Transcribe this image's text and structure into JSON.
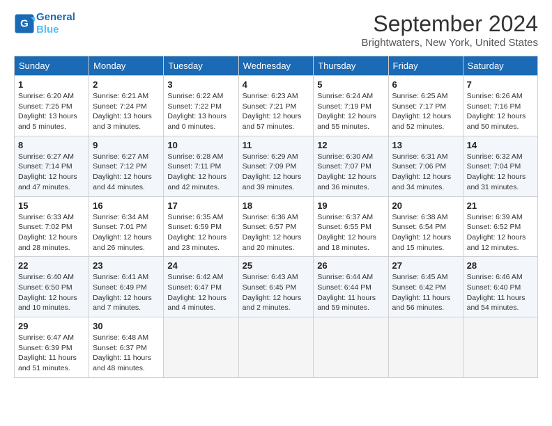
{
  "header": {
    "logo_line1": "General",
    "logo_line2": "Blue",
    "month_title": "September 2024",
    "location": "Brightwaters, New York, United States"
  },
  "days_of_week": [
    "Sunday",
    "Monday",
    "Tuesday",
    "Wednesday",
    "Thursday",
    "Friday",
    "Saturday"
  ],
  "weeks": [
    [
      {
        "day": "1",
        "sunrise": "6:20 AM",
        "sunset": "7:25 PM",
        "daylight": "13 hours and 5 minutes."
      },
      {
        "day": "2",
        "sunrise": "6:21 AM",
        "sunset": "7:24 PM",
        "daylight": "13 hours and 3 minutes."
      },
      {
        "day": "3",
        "sunrise": "6:22 AM",
        "sunset": "7:22 PM",
        "daylight": "13 hours and 0 minutes."
      },
      {
        "day": "4",
        "sunrise": "6:23 AM",
        "sunset": "7:21 PM",
        "daylight": "12 hours and 57 minutes."
      },
      {
        "day": "5",
        "sunrise": "6:24 AM",
        "sunset": "7:19 PM",
        "daylight": "12 hours and 55 minutes."
      },
      {
        "day": "6",
        "sunrise": "6:25 AM",
        "sunset": "7:17 PM",
        "daylight": "12 hours and 52 minutes."
      },
      {
        "day": "7",
        "sunrise": "6:26 AM",
        "sunset": "7:16 PM",
        "daylight": "12 hours and 50 minutes."
      }
    ],
    [
      {
        "day": "8",
        "sunrise": "6:27 AM",
        "sunset": "7:14 PM",
        "daylight": "12 hours and 47 minutes."
      },
      {
        "day": "9",
        "sunrise": "6:27 AM",
        "sunset": "7:12 PM",
        "daylight": "12 hours and 44 minutes."
      },
      {
        "day": "10",
        "sunrise": "6:28 AM",
        "sunset": "7:11 PM",
        "daylight": "12 hours and 42 minutes."
      },
      {
        "day": "11",
        "sunrise": "6:29 AM",
        "sunset": "7:09 PM",
        "daylight": "12 hours and 39 minutes."
      },
      {
        "day": "12",
        "sunrise": "6:30 AM",
        "sunset": "7:07 PM",
        "daylight": "12 hours and 36 minutes."
      },
      {
        "day": "13",
        "sunrise": "6:31 AM",
        "sunset": "7:06 PM",
        "daylight": "12 hours and 34 minutes."
      },
      {
        "day": "14",
        "sunrise": "6:32 AM",
        "sunset": "7:04 PM",
        "daylight": "12 hours and 31 minutes."
      }
    ],
    [
      {
        "day": "15",
        "sunrise": "6:33 AM",
        "sunset": "7:02 PM",
        "daylight": "12 hours and 28 minutes."
      },
      {
        "day": "16",
        "sunrise": "6:34 AM",
        "sunset": "7:01 PM",
        "daylight": "12 hours and 26 minutes."
      },
      {
        "day": "17",
        "sunrise": "6:35 AM",
        "sunset": "6:59 PM",
        "daylight": "12 hours and 23 minutes."
      },
      {
        "day": "18",
        "sunrise": "6:36 AM",
        "sunset": "6:57 PM",
        "daylight": "12 hours and 20 minutes."
      },
      {
        "day": "19",
        "sunrise": "6:37 AM",
        "sunset": "6:55 PM",
        "daylight": "12 hours and 18 minutes."
      },
      {
        "day": "20",
        "sunrise": "6:38 AM",
        "sunset": "6:54 PM",
        "daylight": "12 hours and 15 minutes."
      },
      {
        "day": "21",
        "sunrise": "6:39 AM",
        "sunset": "6:52 PM",
        "daylight": "12 hours and 12 minutes."
      }
    ],
    [
      {
        "day": "22",
        "sunrise": "6:40 AM",
        "sunset": "6:50 PM",
        "daylight": "12 hours and 10 minutes."
      },
      {
        "day": "23",
        "sunrise": "6:41 AM",
        "sunset": "6:49 PM",
        "daylight": "12 hours and 7 minutes."
      },
      {
        "day": "24",
        "sunrise": "6:42 AM",
        "sunset": "6:47 PM",
        "daylight": "12 hours and 4 minutes."
      },
      {
        "day": "25",
        "sunrise": "6:43 AM",
        "sunset": "6:45 PM",
        "daylight": "12 hours and 2 minutes."
      },
      {
        "day": "26",
        "sunrise": "6:44 AM",
        "sunset": "6:44 PM",
        "daylight": "11 hours and 59 minutes."
      },
      {
        "day": "27",
        "sunrise": "6:45 AM",
        "sunset": "6:42 PM",
        "daylight": "11 hours and 56 minutes."
      },
      {
        "day": "28",
        "sunrise": "6:46 AM",
        "sunset": "6:40 PM",
        "daylight": "11 hours and 54 minutes."
      }
    ],
    [
      {
        "day": "29",
        "sunrise": "6:47 AM",
        "sunset": "6:39 PM",
        "daylight": "11 hours and 51 minutes."
      },
      {
        "day": "30",
        "sunrise": "6:48 AM",
        "sunset": "6:37 PM",
        "daylight": "11 hours and 48 minutes."
      },
      null,
      null,
      null,
      null,
      null
    ]
  ]
}
